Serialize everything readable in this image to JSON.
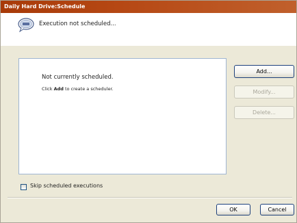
{
  "window": {
    "title": "Daily Hard Drive:Schedule"
  },
  "header": {
    "status_text": "Execution not scheduled...",
    "status_icon": "speech-bubble-icon"
  },
  "panel": {
    "title": "Not currently scheduled.",
    "hint_prefix": "Click ",
    "hint_bold": "Add",
    "hint_suffix": " to create a scheduler."
  },
  "buttons": {
    "add": "Add...",
    "modify": "Modify...",
    "delete": "Delete...",
    "ok": "OK",
    "cancel": "Cancel"
  },
  "options": {
    "skip_label": "Skip scheduled executions",
    "skip_checked": false
  },
  "colors": {
    "titlebar": "#b64814",
    "dialog_bg": "#ece9d8",
    "panel_border": "#9fb5d2",
    "button_border": "#1c3f7a"
  }
}
